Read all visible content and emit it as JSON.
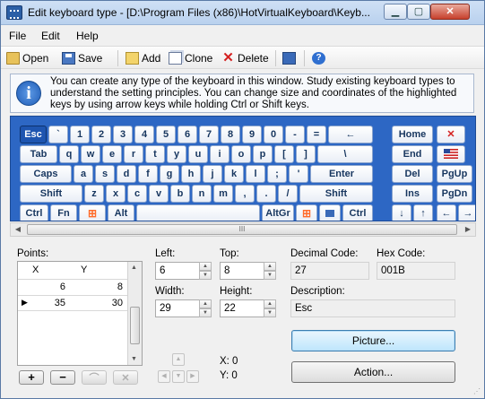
{
  "window": {
    "title": "Edit keyboard type - [D:\\Program Files (x86)\\HotVirtualKeyboard\\Keyb..."
  },
  "menu": [
    "File",
    "Edit",
    "Help"
  ],
  "toolbar": {
    "open": "Open",
    "save": "Save",
    "add": "Add",
    "clone": "Clone",
    "delete": "Delete"
  },
  "info_text": "You can create any type of the keyboard in this window. Study existing keyboard types to understand the setting principles. You can change size and coordinates of the highlighted keys by using arrow keys while holding Ctrl or Shift keys.",
  "keyboard": {
    "row1": [
      "Esc",
      "`",
      "1",
      "2",
      "3",
      "4",
      "5",
      "6",
      "7",
      "8",
      "9",
      "0",
      "-",
      "=",
      "←"
    ],
    "row2": [
      "Tab",
      "q",
      "w",
      "e",
      "r",
      "t",
      "y",
      "u",
      "i",
      "o",
      "p",
      "[",
      "]",
      "\\"
    ],
    "row3": [
      "Caps",
      "a",
      "s",
      "d",
      "f",
      "g",
      "h",
      "j",
      "k",
      "l",
      ";",
      "'",
      "Enter"
    ],
    "row4": [
      "Shift",
      "z",
      "x",
      "c",
      "v",
      "b",
      "n",
      "m",
      ",",
      ".",
      "/",
      "Shift"
    ],
    "row5_left": [
      "Ctrl",
      "Fn"
    ],
    "alt": "Alt",
    "altgr": "AltGr",
    "ctrl_right": "Ctrl",
    "nav": [
      "Home",
      "End",
      "PgUp",
      "Del",
      "PgDn",
      "Ins"
    ],
    "arrows": [
      "↓",
      "↑",
      "←",
      "→"
    ],
    "close_key": "✕",
    "selected_key": "Esc"
  },
  "hscroll_grip": "III",
  "points": {
    "label": "Points:",
    "columns": [
      "X",
      "Y"
    ],
    "rows": [
      {
        "x": "6",
        "y": "8"
      },
      {
        "x": "35",
        "y": "30"
      }
    ],
    "current_row_marker": "▶"
  },
  "fields": {
    "left_label": "Left:",
    "left_value": "6",
    "top_label": "Top:",
    "top_value": "8",
    "width_label": "Width:",
    "width_value": "29",
    "height_label": "Height:",
    "height_value": "22",
    "decimal_label": "Decimal Code:",
    "decimal_value": "27",
    "hex_label": "Hex Code:",
    "hex_value": "001B",
    "description_label": "Description:",
    "description_value": "Esc"
  },
  "buttons": {
    "picture": "Picture...",
    "action": "Action..."
  },
  "coords": {
    "x": "X: 0",
    "y": "Y: 0"
  },
  "grid_buttons": {
    "add": "+",
    "remove": "−"
  }
}
